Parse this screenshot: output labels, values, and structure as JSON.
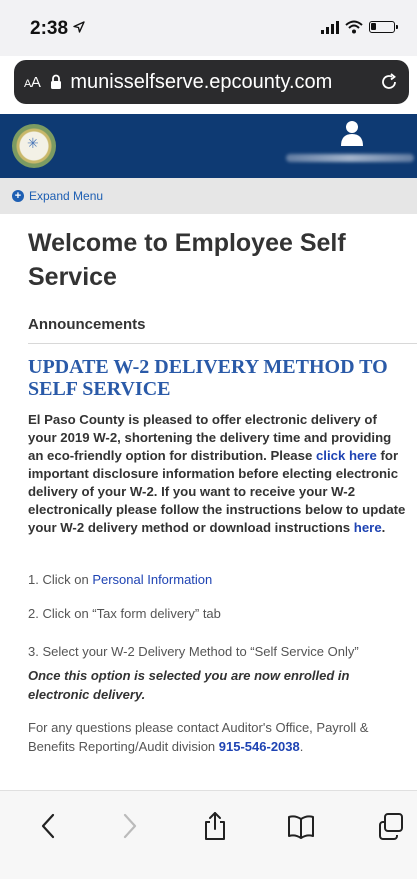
{
  "status_bar": {
    "time": "2:38"
  },
  "browser": {
    "text_size_label": "AA",
    "url": "munisselfserve.epcounty.com"
  },
  "menu": {
    "expand_label": "Expand Menu"
  },
  "page": {
    "title": "Welcome to Employee Self Service"
  },
  "announcements": {
    "section_label": "Announcements",
    "heading": "UPDATE W-2 DELIVERY METHOD TO SELF SERVICE",
    "body_part1": "El Paso County is pleased to offer electronic delivery of your 2019 W-2, shortening the delivery time and providing an eco-friendly option for distribution. Please ",
    "click_here_label": "click here",
    "body_part2": " for important disclosure information before electing electronic delivery of your W-2. If you want to receive your W-2 electronically please follow the instructions below to update your W-2 delivery method or download instructions ",
    "here_label": "here",
    "body_part3": ".",
    "step1_prefix": "1. Click on ",
    "step1_link": "Personal Information",
    "step2": "2. Click on “Tax form delivery” tab",
    "step3": "3. Select your W-2 Delivery Method to “Self Service Only”",
    "enrolled_note": "Once this option is selected you are now enrolled in electronic delivery.",
    "contact_text": "For any questions please contact Auditor's Office, Payroll & Benefits Reporting/Audit division ",
    "phone": "915-546-2038",
    "contact_suffix": "."
  },
  "icons": {
    "status": [
      "location-arrow-icon",
      "signal-icon",
      "wifi-icon",
      "battery-icon"
    ],
    "browser": [
      "lock-icon",
      "reload-icon"
    ],
    "toolbar": [
      "back-icon",
      "forward-icon",
      "share-icon",
      "bookmarks-icon",
      "tabs-icon"
    ]
  },
  "colors": {
    "header_blue": "#0e3a73",
    "link_blue": "#1e43b3",
    "heading_blue": "#2a5aa8",
    "menu_bar_gray": "#e6e6e6"
  }
}
